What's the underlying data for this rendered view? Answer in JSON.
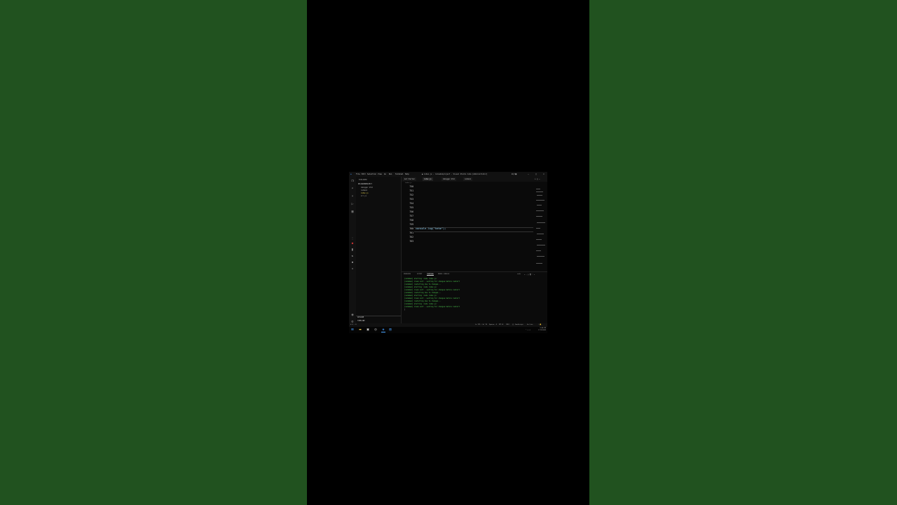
{
  "window": {
    "menu": [
      "File",
      "Edit",
      "Selection",
      "View",
      "Go",
      "Run",
      "Terminal",
      "Help"
    ],
    "title": "● index.js - reloadonproject - Visual Studio Code [Administrator]"
  },
  "explorer": {
    "title": "EXPLORER",
    "root": "RELOADONPROJECT",
    "items": [
      "debugger.html",
      "nodemon",
      "index.js",
      "src.js"
    ],
    "outline": "OUTLINE",
    "timeline": "TIMELINE"
  },
  "tabs": [
    {
      "label": "Get Started"
    },
    {
      "label": "index.js"
    },
    {
      "label": "debugger.html"
    },
    {
      "label": "nodemon"
    }
  ],
  "breadcrumb": "index.js",
  "editor": {
    "line_numbers": [
      "750",
      "751",
      "752",
      "753",
      "754",
      "755",
      "756",
      "757",
      "758",
      "759",
      "760",
      "761",
      "762",
      "763"
    ],
    "code": "console.log(\"hehe\");"
  },
  "panel": {
    "tabs": [
      "PROBLEMS",
      "OUTPUT",
      "TERMINAL",
      "DEBUG CONSOLE"
    ],
    "active_tab": "TERMINAL",
    "terminal_label": "node",
    "lines": [
      "[nodemon] starting `node index.js`",
      "[nodemon] clean exit - waiting for changes before restart",
      "[nodemon] restarting due to changes...",
      "[nodemon] starting `node index.js`",
      "[nodemon] clean exit - waiting for changes before restart",
      "[nodemon] restarting due to changes...",
      "[nodemon] starting `node index.js`",
      "[nodemon] clean exit - waiting for changes before restart",
      "[nodemon] restarting due to changes...",
      "[nodemon] starting `node index.js`",
      "[nodemon] clean exit - waiting for changes before restart"
    ]
  },
  "status": {
    "left": "⊗ 0 ⚠ 0",
    "position": "Ln 757, Col 19",
    "spaces": "Spaces: 4",
    "encoding": "UTF-8",
    "eol": "CRLF",
    "language": "{} JavaScript",
    "golive": "Go Live"
  },
  "taskbar": {
    "time": "5:40 PM",
    "date": "7/11/2022"
  }
}
